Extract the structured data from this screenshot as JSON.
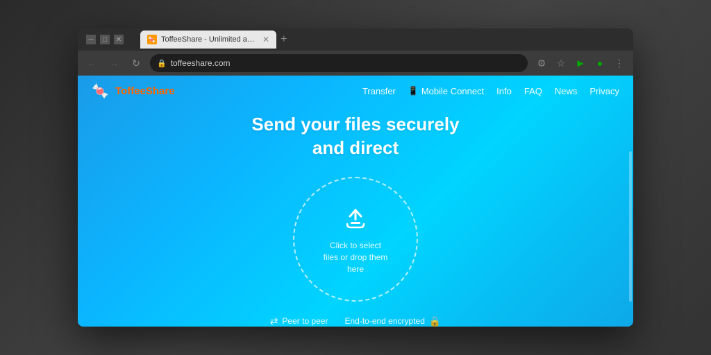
{
  "desktop": {
    "background": "#383838"
  },
  "browser": {
    "tab": {
      "favicon": "🍬",
      "title": "ToffeeShare - Unlimited and sec...",
      "active": true
    },
    "new_tab_label": "+",
    "nav": {
      "back_icon": "←",
      "forward_icon": "→",
      "reload_icon": "↻",
      "url": "toffeeshare.com",
      "lock_icon": "🔒"
    },
    "actions": {
      "settings_icon": "⋮",
      "star_icon": "☆",
      "extension_icon": "▶",
      "profile_icon": "●",
      "menu_icon": "⋮"
    },
    "window_controls": {
      "minimize": "─",
      "maximize": "□",
      "close": "✕"
    }
  },
  "website": {
    "logo": {
      "emoji": "🍬",
      "text": "ToffeeShare"
    },
    "nav": {
      "items": [
        {
          "label": "Transfer",
          "id": "transfer"
        },
        {
          "label": "Mobile Connect",
          "id": "mobile-connect",
          "icon": "📱"
        },
        {
          "label": "Info",
          "id": "info"
        },
        {
          "label": "FAQ",
          "id": "faq"
        },
        {
          "label": "News",
          "id": "news"
        },
        {
          "label": "Privacy",
          "id": "privacy"
        }
      ]
    },
    "hero": {
      "title_line1": "Send your files securely",
      "title_line2": "and direct"
    },
    "upload": {
      "text_line1": "Click to select",
      "text_line2": "files or drop them",
      "text_line3": "here"
    },
    "features": [
      {
        "label": "Peer to peer",
        "icon": "⇄"
      },
      {
        "label": "End-to-end encrypted",
        "icon": "🔒"
      }
    ]
  }
}
